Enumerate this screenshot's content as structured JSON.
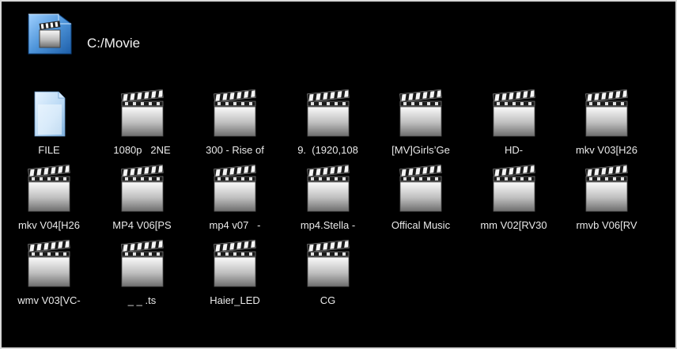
{
  "header": {
    "path": "C:/Movie",
    "icon": "folder-video-icon"
  },
  "items": [
    {
      "label": "FILE",
      "icon": "folder-icon"
    },
    {
      "label": "1080p   2NE",
      "icon": "video-clapper-icon"
    },
    {
      "label": "300 - Rise of",
      "icon": "video-clapper-icon"
    },
    {
      "label": "9.  (1920,108",
      "icon": "video-clapper-icon"
    },
    {
      "label": "[MV]Girls’Ge",
      "icon": "video-clapper-icon"
    },
    {
      "label": "HD-",
      "icon": "video-clapper-icon"
    },
    {
      "label": "mkv V03[H26",
      "icon": "video-clapper-icon"
    },
    {
      "label": "mkv V04[H26",
      "icon": "video-clapper-icon"
    },
    {
      "label": "MP4 V06[PS",
      "icon": "video-clapper-icon"
    },
    {
      "label": "mp4 v07   -",
      "icon": "video-clapper-icon"
    },
    {
      "label": "mp4.Stella -",
      "icon": "video-clapper-icon"
    },
    {
      "label": "Offical Music",
      "icon": "video-clapper-icon"
    },
    {
      "label": "mm V02[RV30",
      "icon": "video-clapper-icon"
    },
    {
      "label": "rmvb V06[RV",
      "icon": "video-clapper-icon"
    },
    {
      "label": "wmv V03[VC-",
      "icon": "video-clapper-icon"
    },
    {
      "label": "_ _ .ts",
      "icon": "video-clapper-icon"
    },
    {
      "label": "Haier_LED",
      "icon": "video-clapper-icon"
    },
    {
      "label": "CG",
      "icon": "video-clapper-icon"
    }
  ]
}
